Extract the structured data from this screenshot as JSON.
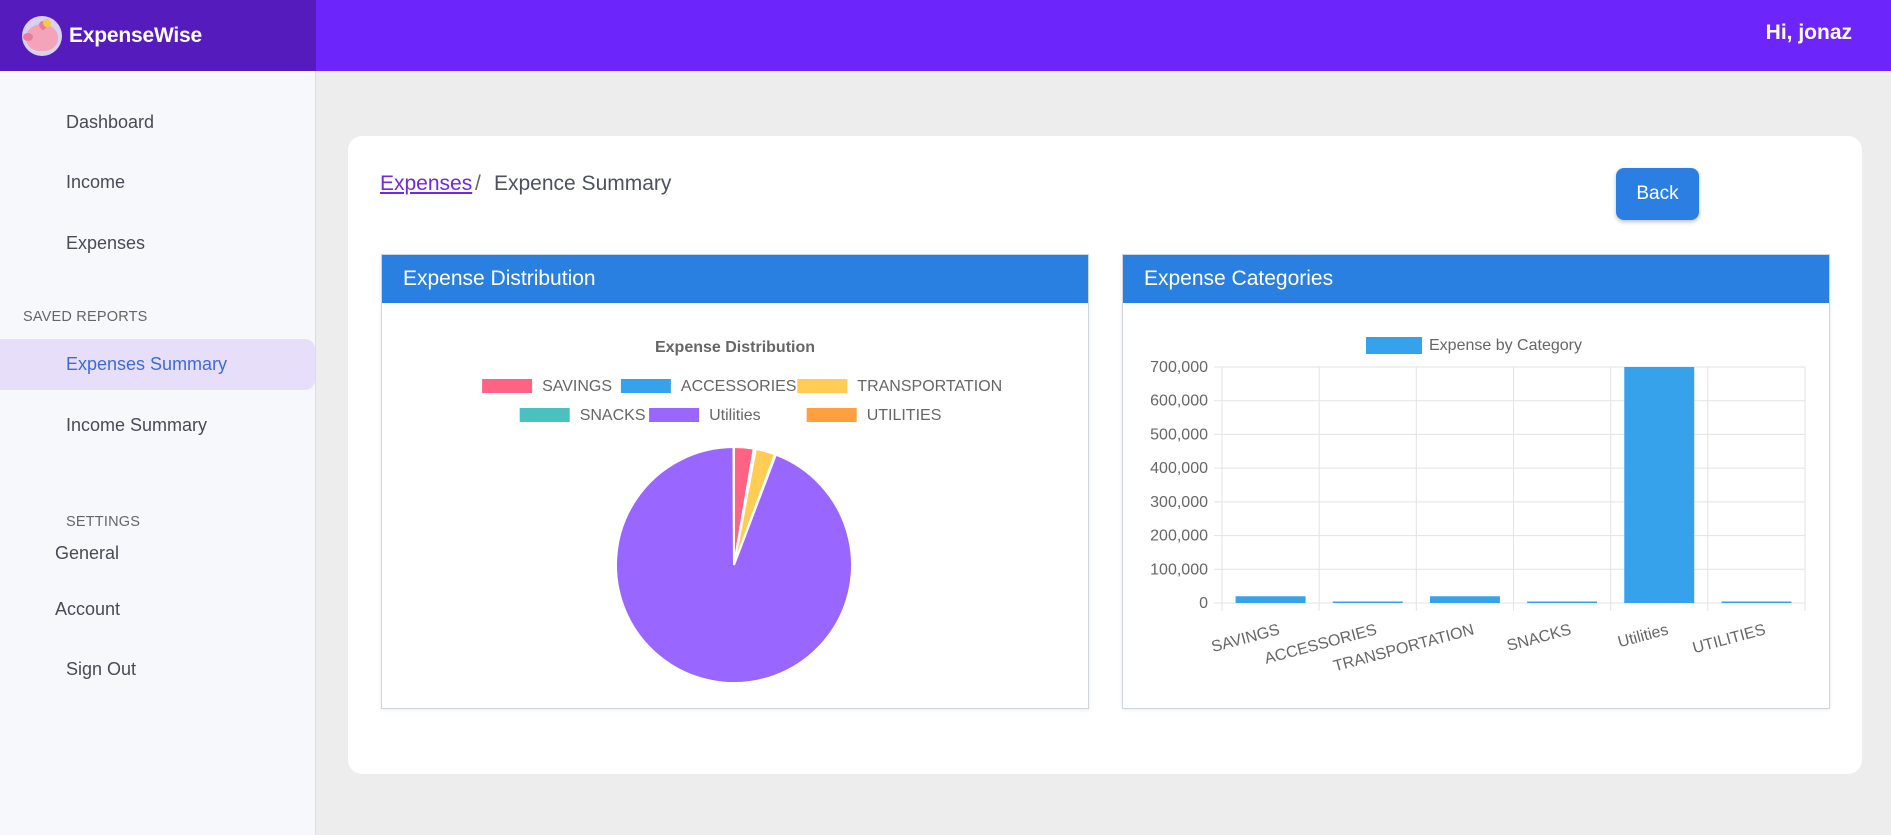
{
  "app": {
    "name": "ExpenseWise",
    "greeting": "Hi, jonaz"
  },
  "sidebar": {
    "items": [
      {
        "label": "Dashboard"
      },
      {
        "label": "Income"
      },
      {
        "label": "Expenses"
      }
    ],
    "saved_reports_label": "SAVED REPORTS",
    "reports": [
      {
        "label": "Expenses Summary",
        "active": true
      },
      {
        "label": "Income Summary",
        "active": false
      }
    ],
    "settings_label": "SETTINGS",
    "settings": [
      {
        "label": "General"
      },
      {
        "label": "Account"
      },
      {
        "label": "Sign Out"
      }
    ]
  },
  "breadcrumb": {
    "link": "Expenses",
    "separator": "/",
    "current": "Expence Summary"
  },
  "back_button": "Back",
  "panels": {
    "pie_title": "Expense Distribution",
    "bar_title": "Expense Categories"
  },
  "chart_data": [
    {
      "type": "pie",
      "title": "Expense Distribution",
      "categories": [
        "SAVINGS",
        "ACCESSORIES",
        "TRANSPORTATION",
        "SNACKS",
        "Utilities",
        "UTILITIES"
      ],
      "values": [
        20000,
        2000,
        20000,
        1000,
        700000,
        500
      ],
      "colors": [
        "#ff6384",
        "#36a2eb",
        "#ffcd56",
        "#4bc0c0",
        "#9966ff",
        "#ff9f40"
      ],
      "legend": "top"
    },
    {
      "type": "bar",
      "categories": [
        "SAVINGS",
        "ACCESSORIES",
        "TRANSPORTATION",
        "SNACKS",
        "Utilities",
        "UTILITIES"
      ],
      "series": [
        {
          "name": "Expense by Category",
          "values": [
            20000,
            2000,
            20000,
            1000,
            700000,
            500
          ]
        }
      ],
      "yticks": [
        "0",
        "100,000",
        "200,000",
        "300,000",
        "400,000",
        "500,000",
        "600,000",
        "700,000"
      ],
      "ylim": [
        0,
        700000
      ],
      "color": "#36a2eb",
      "grid": true,
      "legend": "top"
    }
  ]
}
